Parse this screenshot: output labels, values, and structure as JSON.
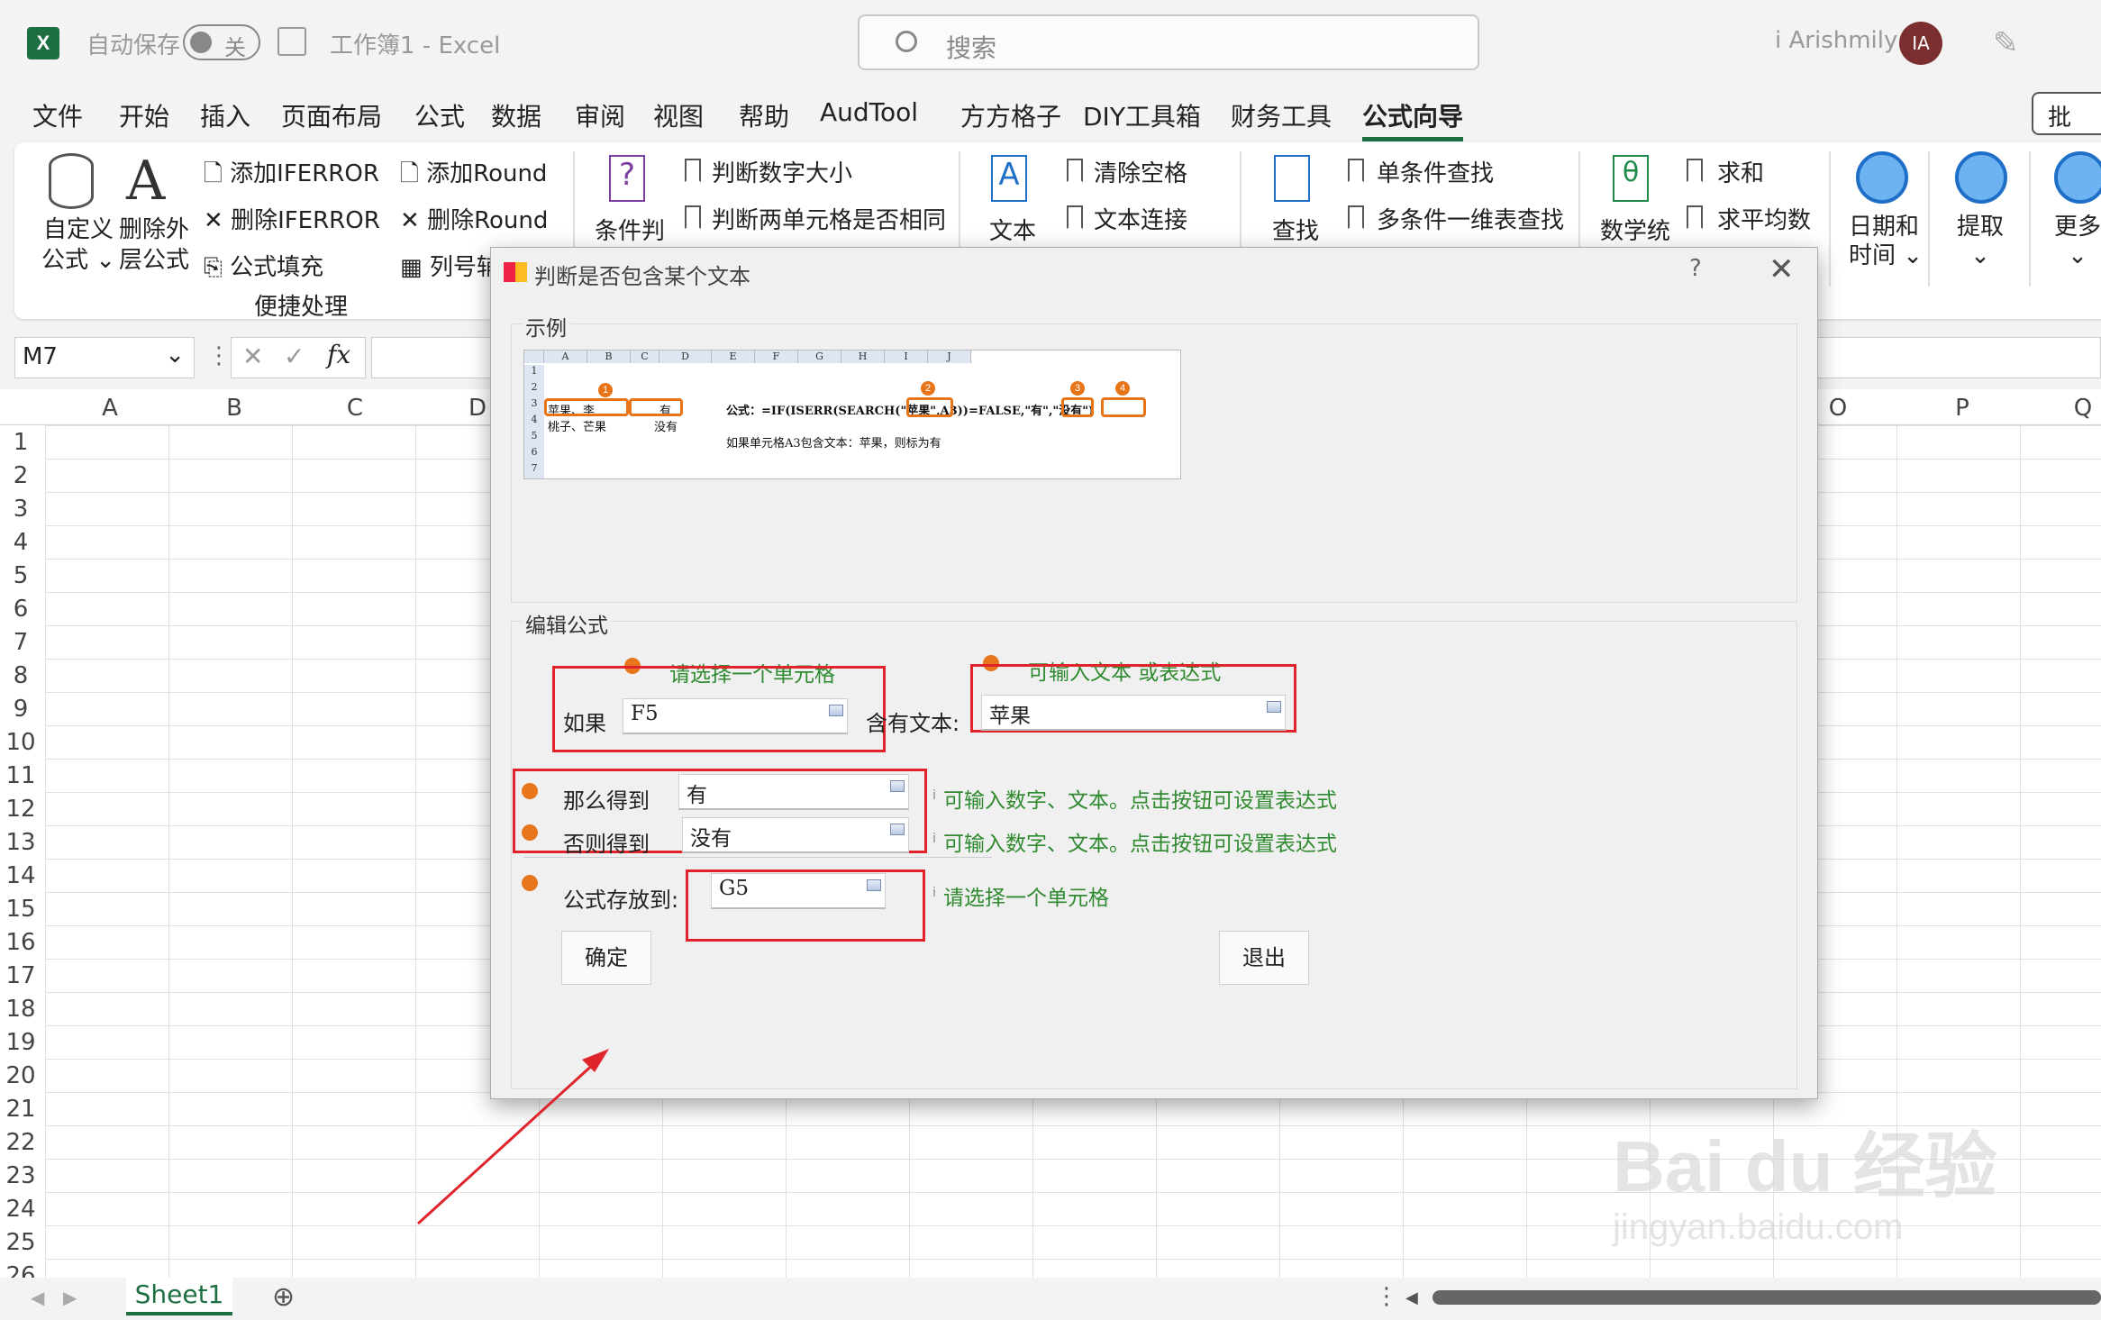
{
  "titlebar": {
    "autosave": "自动保存",
    "toggle": "关",
    "doc": "工作簿1  -  Excel",
    "search_placeholder": "搜索",
    "user": "i Arishmily",
    "avatar": "IA",
    "app_icon": "X"
  },
  "menu": [
    "文件",
    "开始",
    "插入",
    "页面布局",
    "公式",
    "数据",
    "审阅",
    "视图",
    "帮助",
    "AudTool",
    "方方格子",
    "DIY工具箱",
    "财务工具",
    "公式向导"
  ],
  "share": "批",
  "ribbon": {
    "custom": [
      "自定义",
      "公式 ⌄"
    ],
    "removeOuter": [
      "删除外",
      "层公式"
    ],
    "addIferror": "添加IFERROR",
    "delIferror": "删除IFERROR",
    "fill": "公式填充",
    "addRound": "添加Round",
    "delRound": "删除Round",
    "colnum": "列号辅",
    "group_label": "便捷处理",
    "cond": "条件判",
    "numCmp": "判断数字大小",
    "cellSame": "判断两单元格是否相同",
    "text": "文本",
    "trim": "清除空格",
    "concat": "文本连接",
    "find": "查找",
    "single": "单条件查找",
    "multi": "多条件一维表查找",
    "math": "数学统",
    "sum": "求和",
    "avg": "求平均数",
    "date": [
      "日期和",
      "时间 ⌄"
    ],
    "extract": [
      "提取",
      "⌄"
    ],
    "more": [
      "更多",
      "⌄"
    ]
  },
  "namebox": "M7",
  "columns": [
    "A",
    "B",
    "C",
    "D",
    "O",
    "P",
    "Q"
  ],
  "rows": [
    "1",
    "2",
    "3",
    "4",
    "5",
    "6",
    "7",
    "8",
    "9",
    "10",
    "11",
    "12",
    "13",
    "14",
    "15",
    "16",
    "17",
    "18",
    "19",
    "20",
    "21",
    "22",
    "23",
    "24",
    "25",
    "26"
  ],
  "sheet_tab": "Sheet1",
  "dialog": {
    "title": "判断是否包含某个文本",
    "help": "?",
    "close": "✕",
    "example_label": "示例",
    "mini_cols": [
      "A",
      "B",
      "C",
      "D",
      "E",
      "F",
      "G",
      "H",
      "I",
      "J"
    ],
    "mini_rows": [
      "1",
      "2",
      "3",
      "4",
      "5",
      "6",
      "7"
    ],
    "mini_a3": "苹果、李",
    "mini_b3": "有",
    "mini_a4": "桃子、芒果",
    "mini_b4": "没有",
    "mini_formula": "公式：=IF(ISERR(SEARCH(\"苹果\",A3))=FALSE,\"有\",\"没有\")",
    "mini_note": "如果单元格A3包含文本：苹果，则标为有",
    "mini_nums": [
      "1",
      "2",
      "3",
      "4"
    ],
    "edit_label": "编辑公式",
    "hint_cell": "请选择一个单元格",
    "hint_text": "可输入文本 或表达式",
    "if_label": "如果",
    "if_value": "F5",
    "contains_label": "含有文本:",
    "contains_value": "苹果",
    "then_label": "那么得到",
    "then_value": "有",
    "else_label": "否则得到",
    "else_value": "没有",
    "hint_val": "可输入数字、文本。点击按钮可设置表达式",
    "store_label": "公式存放到:",
    "store_value": "G5",
    "hint_store": "请选择一个单元格",
    "ok": "确定",
    "exit": "退出",
    "info": "i"
  },
  "watermark": [
    "Bai du 经验",
    "jingyan.baidu.com"
  ]
}
